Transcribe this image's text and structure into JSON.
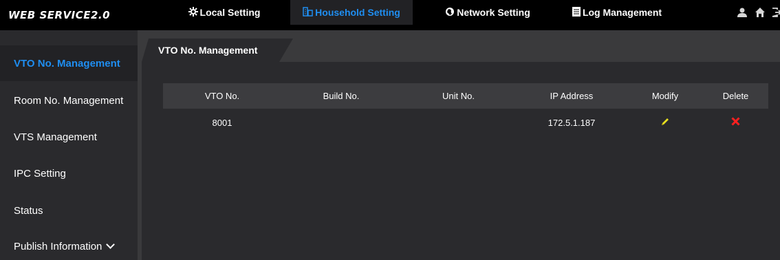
{
  "header": {
    "brand": "WEB SERVICE2.0",
    "tabs": [
      {
        "label": "Local Setting",
        "icon": "gear-icon"
      },
      {
        "label": "Household Setting",
        "icon": "building-icon",
        "active": true
      },
      {
        "label": "Network Setting",
        "icon": "globe-icon"
      },
      {
        "label": "Log Management",
        "icon": "log-icon"
      }
    ],
    "right_icons": [
      "user-icon",
      "home-icon",
      "logout-icon"
    ]
  },
  "sidebar": {
    "items": [
      {
        "label": "VTO No. Management",
        "active": true
      },
      {
        "label": "Room No. Management"
      },
      {
        "label": "VTS Management"
      },
      {
        "label": "IPC Setting"
      },
      {
        "label": "Status"
      },
      {
        "label": "Publish Information",
        "icon": "chevron-down-icon"
      }
    ]
  },
  "content": {
    "tab_title": "VTO No. Management",
    "table": {
      "headers": [
        "VTO No.",
        "Build No.",
        "Unit No.",
        "IP Address",
        "Modify",
        "Delete"
      ],
      "rows": [
        {
          "vto_no": "8001",
          "build_no": "",
          "unit_no": "",
          "ip": "172.5.1.187"
        }
      ]
    }
  },
  "colors": {
    "accent": "#1f8ef1",
    "topbar": "#000000",
    "sidebar": "#2a2a2d",
    "modify": "#e8e020",
    "delete": "#ff2020"
  }
}
